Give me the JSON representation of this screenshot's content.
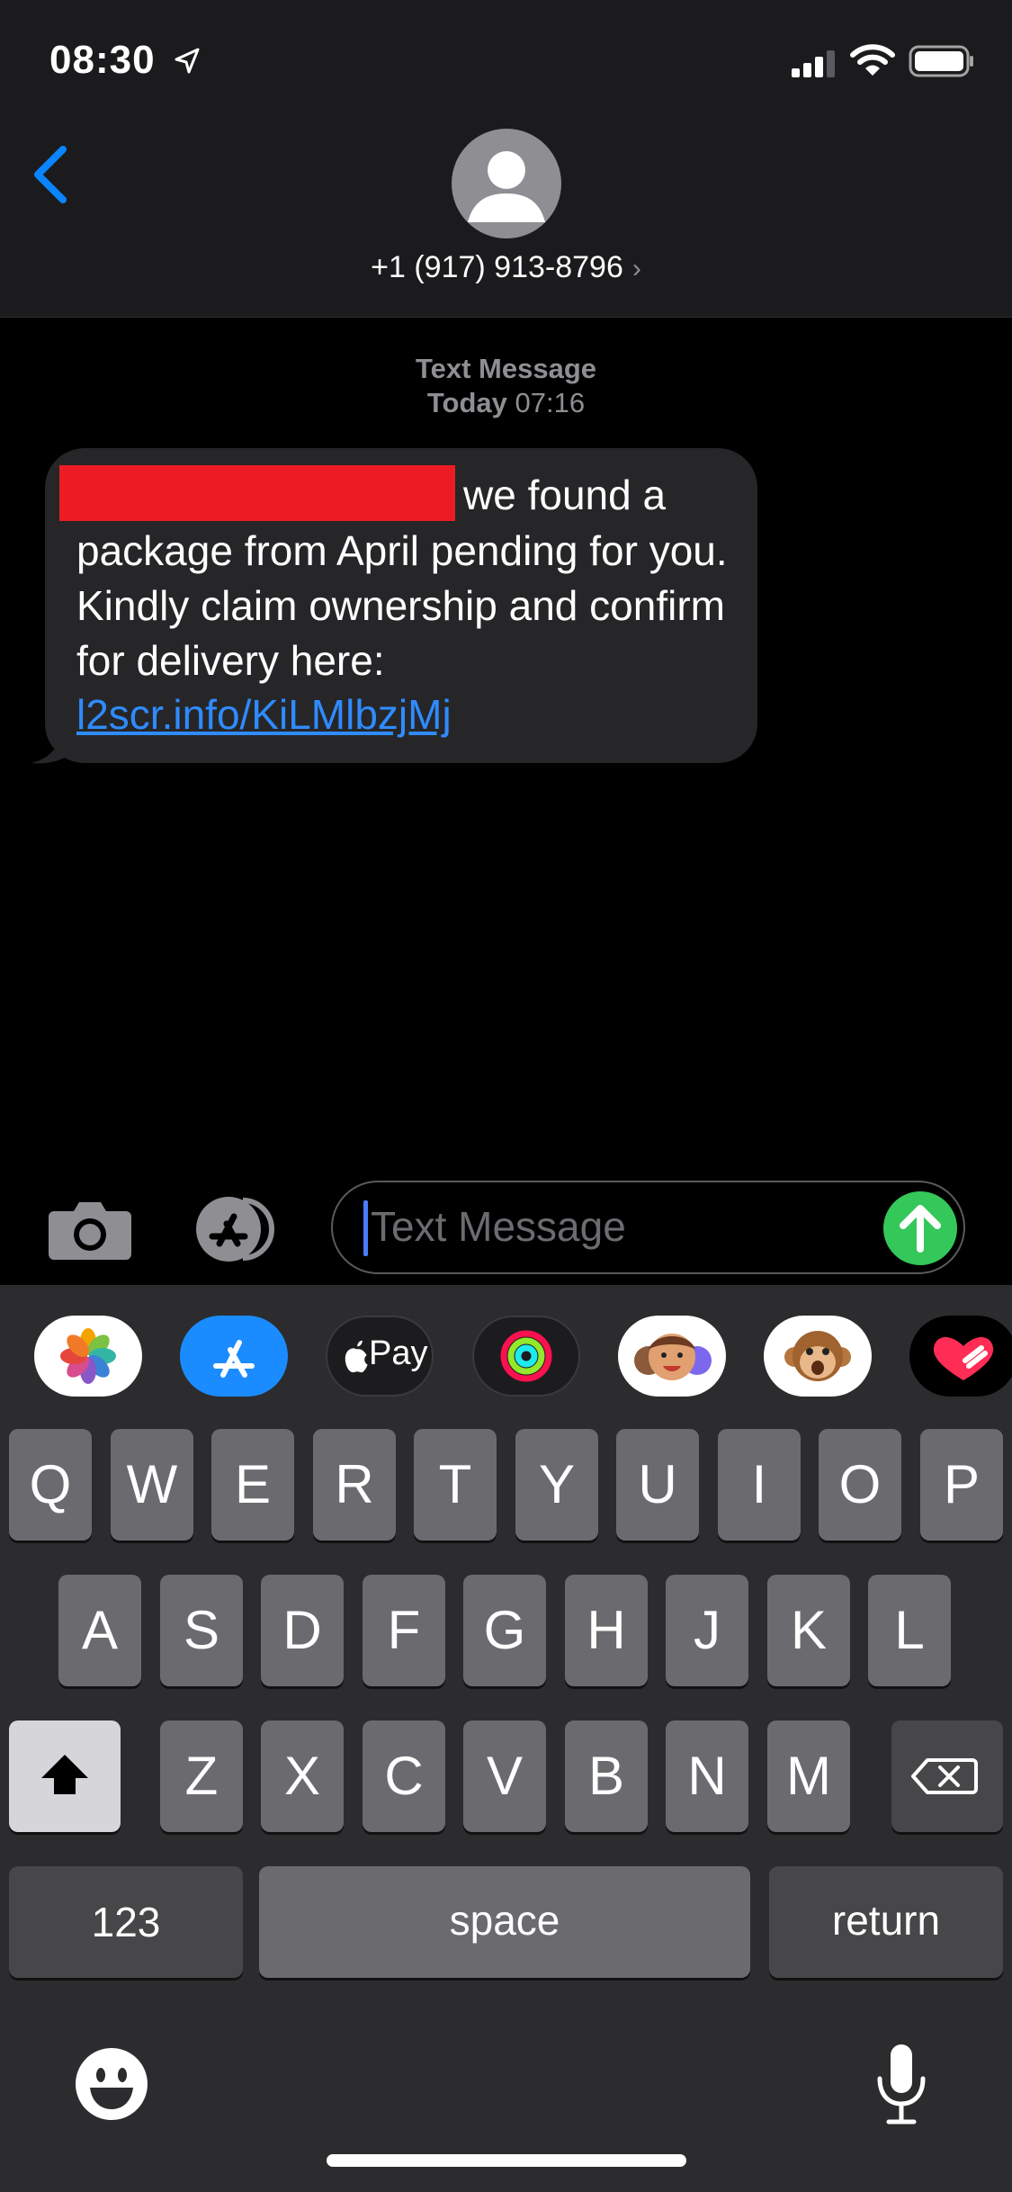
{
  "status_bar": {
    "time": "08:30"
  },
  "header": {
    "contact_number": "+1 (917) 913-8796",
    "chevron": "›"
  },
  "thread": {
    "label": "Text Message",
    "date_bold": "Today",
    "time": "07:16"
  },
  "message": {
    "first_line": "we found a",
    "body": "package from April pending for you. Kindly claim ownership and confirm for delivery here:",
    "link": "l2scr.info/KiLMlbzjMj"
  },
  "composer": {
    "placeholder": "Text Message"
  },
  "app_strip": {
    "apple_pay_label": "Pay"
  },
  "keyboard": {
    "row1": [
      "Q",
      "W",
      "E",
      "R",
      "T",
      "Y",
      "U",
      "I",
      "O",
      "P"
    ],
    "row2": [
      "A",
      "S",
      "D",
      "F",
      "G",
      "H",
      "J",
      "K",
      "L"
    ],
    "row3": [
      "Z",
      "X",
      "C",
      "V",
      "B",
      "N",
      "M"
    ],
    "numbers_label": "123",
    "space_label": "space",
    "return_label": "return"
  },
  "colors": {
    "accent_blue": "#0a84ff",
    "link_blue": "#2f8bff",
    "send_green": "#34c759",
    "redaction_red": "#ed1c24"
  }
}
